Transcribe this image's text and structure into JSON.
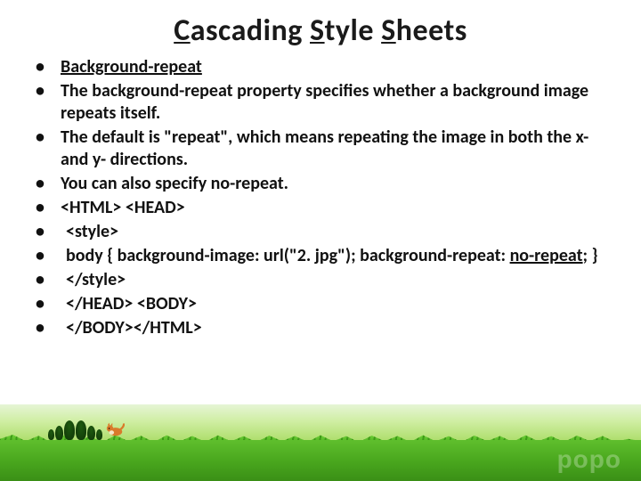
{
  "title_parts": {
    "c": "C",
    "ascading": "ascading",
    "s1": "S",
    "tyle": "tyle",
    "s2": "S",
    "heets": "heets"
  },
  "bullets": [
    {
      "text": "Background-repeat",
      "bold_under": true
    },
    {
      "text": "The background-repeat property specifies whether a background image repeats itself."
    },
    {
      "text": "The default is \"repeat\", which means repeating the image in both the x- and y- directions."
    },
    {
      "text": "You can also specify no-repeat."
    },
    {
      "text": "<HTML> <HEAD>"
    },
    {
      "text": " <style>",
      "indent": true
    },
    {
      "prefix": " body { background-image: url(\"2. jpg\");   background-repeat: ",
      "under": "no-repeat",
      "suffix": "; }",
      "indent": true,
      "has_under": true
    },
    {
      "text": " </style>",
      "indent": true
    },
    {
      "text": " </HEAD> <BODY>",
      "indent": true
    },
    {
      "text": " </BODY></HTML>",
      "indent": true
    }
  ],
  "watermark": "popo"
}
